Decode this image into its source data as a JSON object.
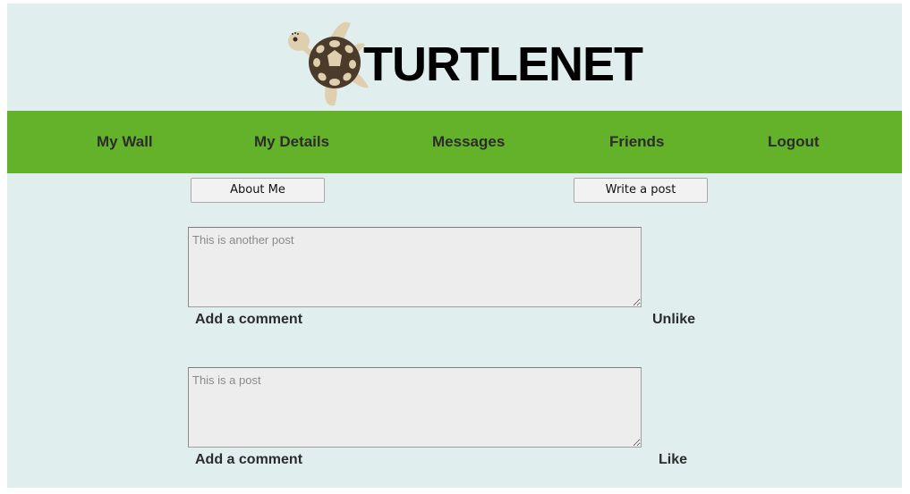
{
  "header": {
    "logo_text": "TURTLENET",
    "logo_icon": "turtle-icon"
  },
  "nav": {
    "items": [
      {
        "label": "My Wall"
      },
      {
        "label": "My Details"
      },
      {
        "label": "Messages"
      },
      {
        "label": "Friends"
      },
      {
        "label": "Logout"
      }
    ]
  },
  "toolbar": {
    "about_label": "About Me",
    "write_label": "Write a post"
  },
  "posts": [
    {
      "placeholder": "This is another post",
      "comment_label": "Add a comment",
      "like_label": "Unlike"
    },
    {
      "placeholder": "This is a post",
      "comment_label": "Add a comment",
      "like_label": "Like"
    }
  ],
  "colors": {
    "background": "#e0eeee",
    "navbar": "#64b22a",
    "turtle_shell": "#4a3b2a",
    "turtle_skin": "#dfcfae"
  }
}
